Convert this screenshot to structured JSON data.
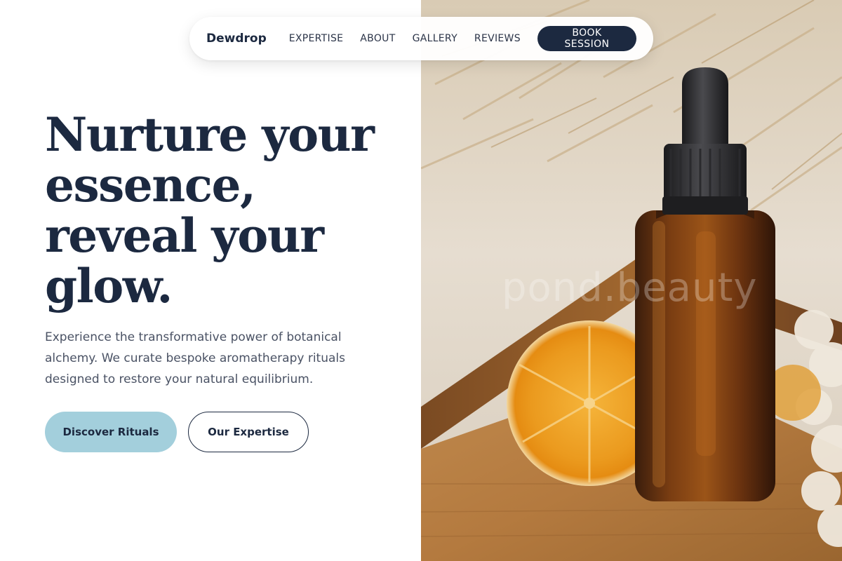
{
  "nav": {
    "brand": "Dewdrop",
    "links": [
      "EXPERTISE",
      "ABOUT",
      "GALLERY",
      "REVIEWS"
    ],
    "cta": "BOOK SESSION"
  },
  "hero": {
    "title": "Nurture your essence, reveal your glow.",
    "description": "Experience the transformative power of botanical alchemy. We curate bespoke aromatherapy rituals designed to restore your natural equilibrium.",
    "primary_button": "Discover Rituals",
    "secondary_button": "Our Expertise"
  },
  "photo": {
    "watermark": "pond.beauty",
    "subject": "amber dropper bottle with dried orange slice on wooden tray"
  },
  "colors": {
    "navy": "#1c2940",
    "accent_blue": "#a3cfdc",
    "body_text": "#4a5264"
  }
}
